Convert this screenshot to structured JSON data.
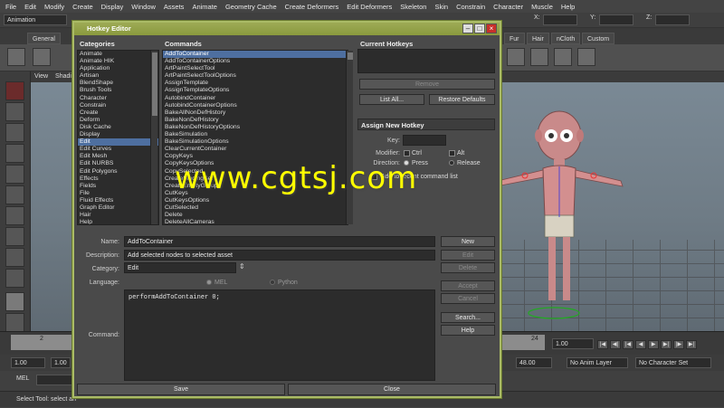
{
  "menu": [
    "File",
    "Edit",
    "Modify",
    "Create",
    "Display",
    "Window",
    "Assets",
    "Animate",
    "Geometry Cache",
    "Create Deformers",
    "Edit Deformers",
    "Skeleton",
    "Skin",
    "Constrain",
    "Character",
    "Muscle",
    "Help"
  ],
  "mode_selector": "Animation",
  "coords": {
    "x": "X:",
    "y": "Y:",
    "z": "Z:"
  },
  "shelf_tabs": [
    "General",
    "Fur",
    "Hair",
    "nCloth",
    "Custom"
  ],
  "viewport_menu": [
    "View",
    "Shadi"
  ],
  "dialog": {
    "title": "Hotkey Editor",
    "categories_header": "Categories",
    "commands_header": "Commands",
    "current_hotkeys_header": "Current Hotkeys",
    "assign_header": "Assign New Hotkey",
    "categories": [
      "Animate",
      "Animate HIK",
      "Application",
      "Artisan",
      "BlendShape",
      "Brush Tools",
      "Character",
      "Constrain",
      "Create",
      "Deform",
      "Disk Cache",
      "Display",
      "Edit",
      "Edit Curves",
      "Edit Mesh",
      "Edit NURBS",
      "Edit Polygons",
      "Effects",
      "Fields",
      "File",
      "Fluid Effects",
      "Graph Editor",
      "Hair",
      "Help"
    ],
    "selected_category": "Edit",
    "commands": [
      "AddToContainer",
      "AddToContainerOptions",
      "ArtPaintSelectTool",
      "ArtPaintSelectToolOptions",
      "AssignTemplate",
      "AssignTemplateOptions",
      "AutobindContainer",
      "AutobindContainerOptions",
      "BakeAllNonDefHistory",
      "BakeNonDefHistory",
      "BakeNonDefHistoryOptions",
      "BakeSimulation",
      "BakeSimulationOptions",
      "ClearCurrentContainer",
      "CopyKeys",
      "CopyKeysOptions",
      "CopySelected",
      "CreateBindingSet",
      "CreateEmptyGroup",
      "CutKeys",
      "CutKeysOptions",
      "CutSelected",
      "Delete",
      "DeleteAllCameras"
    ],
    "selected_command": "AddToContainer",
    "remove_label": "Remove",
    "list_all_label": "List All...",
    "restore_defaults_label": "Restore Defaults",
    "key_label": "Key:",
    "modifier_label": "Modifier:",
    "ctrl_label": "Ctrl",
    "alt_label": "Alt",
    "direction_label": "Direction:",
    "press_label": "Press",
    "release_label": "Release",
    "add_recent_label": "Add to recent command list",
    "name_label": "Name:",
    "name_value": "AddToContainer",
    "description_label": "Description:",
    "description_value": "Add selected nodes to selected asset",
    "category_label": "Category:",
    "category_value": "Edit",
    "language_label": "Language:",
    "mel_label": "MEL",
    "python_label": "Python",
    "command_label": "Command:",
    "command_value": "performAddToContainer 0;",
    "new_label": "New",
    "edit_label": "Edit",
    "delete_label": "Delete",
    "accept_label": "Accept",
    "cancel_label": "Cancel",
    "search_label": "Search...",
    "help_label": "Help",
    "save_label": "Save",
    "close_label": "Close"
  },
  "timeline": {
    "tick_2": "2",
    "tick_24": "24",
    "current_frame": "1.00"
  },
  "range": {
    "start": "1.00",
    "start2": "1.00",
    "end": "48.00",
    "anim_layer": "No Anim Layer",
    "character_set": "No Character Set"
  },
  "cmdline": {
    "label": "MEL"
  },
  "helpline": "Select Tool: select an",
  "watermark": "www.cgtsj.com",
  "colors": {
    "dialog_border": "#aabb66",
    "selection": "#4e6fa0",
    "watermark": "#ffff00"
  }
}
